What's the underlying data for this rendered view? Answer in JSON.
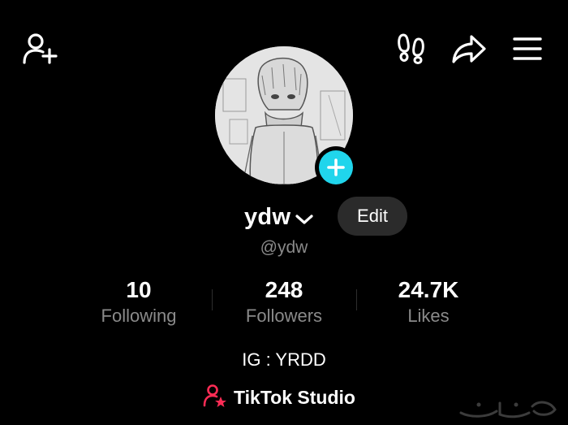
{
  "header": {
    "add_friend_icon": "person-plus-icon",
    "footprints_icon": "footprints-icon",
    "share_icon": "share-arrow-icon",
    "menu_icon": "hamburger-menu-icon"
  },
  "profile": {
    "display_name": "ydw",
    "handle": "@ydw",
    "edit_label": "Edit",
    "bio": "IG : YRDD"
  },
  "stats": [
    {
      "value": "10",
      "label": "Following"
    },
    {
      "value": "248",
      "label": "Followers"
    },
    {
      "value": "24.7K",
      "label": "Likes"
    }
  ],
  "studio": {
    "label": "TikTok Studio",
    "icon": "person-star-icon"
  },
  "colors": {
    "background": "#000000",
    "accent_cyan": "#20d5ec",
    "accent_pink": "#fe2c55",
    "secondary_text": "#8a8a8a",
    "button_bg": "#2b2b2b"
  }
}
